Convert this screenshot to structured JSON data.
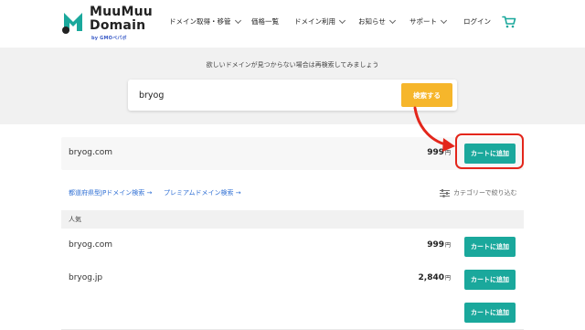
{
  "brand": {
    "line1": "MuuMuu",
    "line2": "Domain",
    "by": "by GMOペパボ",
    "color": "#1aa89c"
  },
  "nav": [
    {
      "label": "ドメイン取得・移管",
      "has_dropdown": true
    },
    {
      "label": "価格一覧",
      "has_dropdown": false
    },
    {
      "label": "ドメイン利用",
      "has_dropdown": true
    },
    {
      "label": "お知らせ",
      "has_dropdown": true
    },
    {
      "label": "サポート",
      "has_dropdown": true
    },
    {
      "label": "ログイン",
      "has_dropdown": false
    }
  ],
  "cart_icon": "shopping-cart-icon",
  "search": {
    "hint": "欲しいドメインが見つからない場合は再検索してみましょう",
    "value": "bryog",
    "button": "検索する",
    "button_color": "#f6b62b"
  },
  "main_result": {
    "domain": "bryog.com",
    "price": "999",
    "currency": "円",
    "add_label": "カートに追加"
  },
  "annotation_color": "#e3261b",
  "links": {
    "prefecture": "都道府県型JPドメイン検索 →",
    "premium": "プレミアムドメイン検索 →",
    "filter": "カテゴリーで絞り込む"
  },
  "popular": {
    "heading": "人気",
    "rows": [
      {
        "domain": "bryog.com",
        "price": "999",
        "currency": "円",
        "add_label": "カートに追加"
      },
      {
        "domain": "bryog.jp",
        "price": "2,840",
        "currency": "円",
        "add_label": "カートに追加"
      },
      {
        "domain": "",
        "price": "",
        "currency": "",
        "add_label": "カートに追加"
      }
    ]
  }
}
